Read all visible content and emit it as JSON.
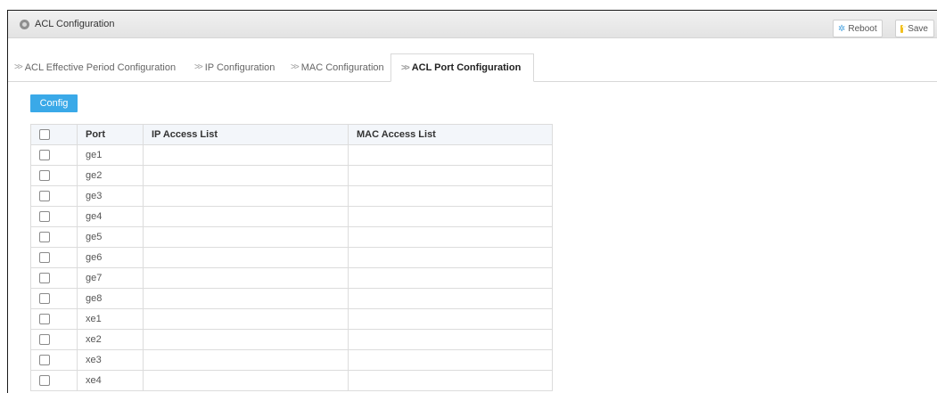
{
  "window": {
    "title": "ACL Configuration",
    "icon": "settings-circle-icon"
  },
  "toolbar": {
    "reboot_label": "Reboot",
    "reboot_icon": "reboot-icon",
    "save_label": "Save",
    "save_icon": "save-icon"
  },
  "tabs": [
    {
      "label": "ACL Effective Period Configuration",
      "active": false
    },
    {
      "label": "IP Configuration",
      "active": false
    },
    {
      "label": "MAC Configuration",
      "active": false
    },
    {
      "label": "ACL Port Configuration",
      "active": true
    }
  ],
  "config_button_label": "Config",
  "table": {
    "headers": [
      "Port",
      "IP Access List",
      "MAC Access List"
    ],
    "rows": [
      {
        "port": "ge1",
        "ip": "",
        "mac": ""
      },
      {
        "port": "ge2",
        "ip": "",
        "mac": ""
      },
      {
        "port": "ge3",
        "ip": "",
        "mac": ""
      },
      {
        "port": "ge4",
        "ip": "",
        "mac": ""
      },
      {
        "port": "ge5",
        "ip": "",
        "mac": ""
      },
      {
        "port": "ge6",
        "ip": "",
        "mac": ""
      },
      {
        "port": "ge7",
        "ip": "",
        "mac": ""
      },
      {
        "port": "ge8",
        "ip": "",
        "mac": ""
      },
      {
        "port": "xe1",
        "ip": "",
        "mac": ""
      },
      {
        "port": "xe2",
        "ip": "",
        "mac": ""
      },
      {
        "port": "xe3",
        "ip": "",
        "mac": ""
      },
      {
        "port": "xe4",
        "ip": "",
        "mac": ""
      }
    ]
  },
  "colors": {
    "accent": "#3aa9e8",
    "header_bg": "#f3f6fa",
    "save_icon": "#f2c01e"
  }
}
